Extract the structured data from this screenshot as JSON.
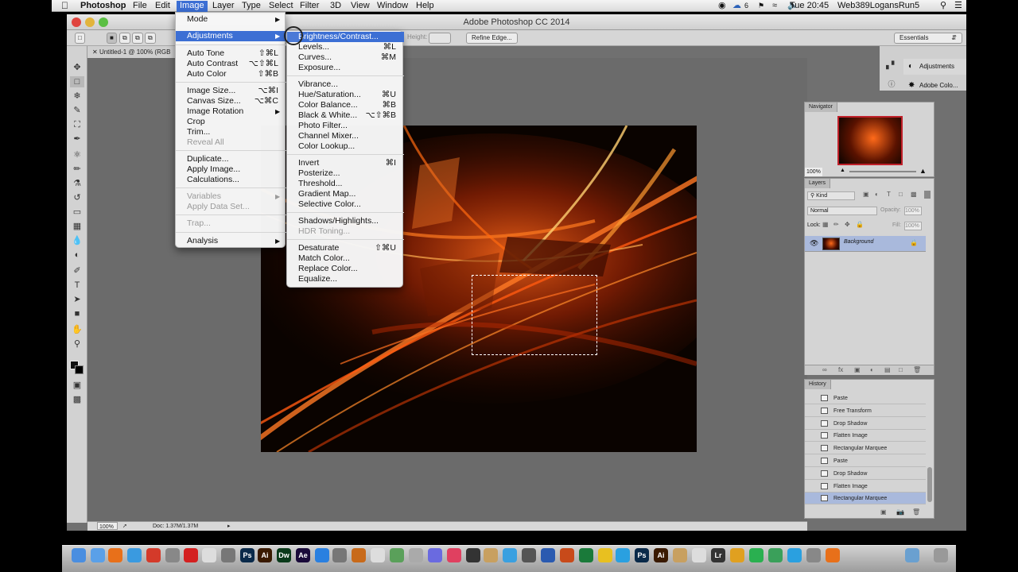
{
  "menubar": {
    "app_name": "Photoshop",
    "menus": [
      "File",
      "Edit",
      "Image",
      "Layer",
      "Type",
      "Select",
      "Filter",
      "3D",
      "View",
      "Window",
      "Help"
    ],
    "active_menu": "Image",
    "wifi_badge": "6",
    "clock": "Tue 20:45",
    "user": "Web389LogansRun5"
  },
  "window": {
    "title": "Adobe Photoshop CC 2014",
    "document_tab": "Untitled-1 @ 100% (RGB",
    "zoom": "100%",
    "doc_size": "Doc: 1.37M/1.37M",
    "options": {
      "height_label": "Height:",
      "refine_edge": "Refine Edge...",
      "workspace": "Essentials"
    }
  },
  "image_menu": {
    "items": [
      {
        "label": "Mode",
        "shortcut": "",
        "submenu": true,
        "disabled": false,
        "highlighted": false
      },
      {
        "label": "Adjustments",
        "shortcut": "",
        "submenu": true,
        "disabled": false,
        "highlighted": true
      },
      {
        "label": "Auto Tone",
        "shortcut": "⇧⌘L",
        "submenu": false,
        "disabled": false,
        "highlighted": false
      },
      {
        "label": "Auto Contrast",
        "shortcut": "⌥⇧⌘L",
        "submenu": false,
        "disabled": false,
        "highlighted": false
      },
      {
        "label": "Auto Color",
        "shortcut": "⇧⌘B",
        "submenu": false,
        "disabled": false,
        "highlighted": false
      },
      {
        "label": "Image Size...",
        "shortcut": "⌥⌘I",
        "submenu": false,
        "disabled": false,
        "highlighted": false
      },
      {
        "label": "Canvas Size...",
        "shortcut": "⌥⌘C",
        "submenu": false,
        "disabled": false,
        "highlighted": false
      },
      {
        "label": "Image Rotation",
        "shortcut": "",
        "submenu": true,
        "disabled": false,
        "highlighted": false
      },
      {
        "label": "Crop",
        "shortcut": "",
        "submenu": false,
        "disabled": false,
        "highlighted": false
      },
      {
        "label": "Trim...",
        "shortcut": "",
        "submenu": false,
        "disabled": false,
        "highlighted": false
      },
      {
        "label": "Reveal All",
        "shortcut": "",
        "submenu": false,
        "disabled": true,
        "highlighted": false
      },
      {
        "label": "Duplicate...",
        "shortcut": "",
        "submenu": false,
        "disabled": false,
        "highlighted": false
      },
      {
        "label": "Apply Image...",
        "shortcut": "",
        "submenu": false,
        "disabled": false,
        "highlighted": false
      },
      {
        "label": "Calculations...",
        "shortcut": "",
        "submenu": false,
        "disabled": false,
        "highlighted": false
      },
      {
        "label": "Variables",
        "shortcut": "",
        "submenu": true,
        "disabled": true,
        "highlighted": false
      },
      {
        "label": "Apply Data Set...",
        "shortcut": "",
        "submenu": false,
        "disabled": true,
        "highlighted": false
      },
      {
        "label": "Trap...",
        "shortcut": "",
        "submenu": false,
        "disabled": true,
        "highlighted": false
      },
      {
        "label": "Analysis",
        "shortcut": "",
        "submenu": true,
        "disabled": false,
        "highlighted": false
      }
    ]
  },
  "adjustments_menu": {
    "items": [
      {
        "label": "Brightness/Contrast...",
        "shortcut": "",
        "disabled": false,
        "highlighted": true
      },
      {
        "label": "Levels...",
        "shortcut": "⌘L",
        "disabled": false,
        "highlighted": false
      },
      {
        "label": "Curves...",
        "shortcut": "⌘M",
        "disabled": false,
        "highlighted": false
      },
      {
        "label": "Exposure...",
        "shortcut": "",
        "disabled": false,
        "highlighted": false
      },
      {
        "label": "Vibrance...",
        "shortcut": "",
        "disabled": false,
        "highlighted": false
      },
      {
        "label": "Hue/Saturation...",
        "shortcut": "⌘U",
        "disabled": false,
        "highlighted": false
      },
      {
        "label": "Color Balance...",
        "shortcut": "⌘B",
        "disabled": false,
        "highlighted": false
      },
      {
        "label": "Black & White...",
        "shortcut": "⌥⇧⌘B",
        "disabled": false,
        "highlighted": false
      },
      {
        "label": "Photo Filter...",
        "shortcut": "",
        "disabled": false,
        "highlighted": false
      },
      {
        "label": "Channel Mixer...",
        "shortcut": "",
        "disabled": false,
        "highlighted": false
      },
      {
        "label": "Color Lookup...",
        "shortcut": "",
        "disabled": false,
        "highlighted": false
      },
      {
        "label": "Invert",
        "shortcut": "⌘I",
        "disabled": false,
        "highlighted": false
      },
      {
        "label": "Posterize...",
        "shortcut": "",
        "disabled": false,
        "highlighted": false
      },
      {
        "label": "Threshold...",
        "shortcut": "",
        "disabled": false,
        "highlighted": false
      },
      {
        "label": "Gradient Map...",
        "shortcut": "",
        "disabled": false,
        "highlighted": false
      },
      {
        "label": "Selective Color...",
        "shortcut": "",
        "disabled": false,
        "highlighted": false
      },
      {
        "label": "Shadows/Highlights...",
        "shortcut": "",
        "disabled": false,
        "highlighted": false
      },
      {
        "label": "HDR Toning...",
        "shortcut": "",
        "disabled": true,
        "highlighted": false
      },
      {
        "label": "Desaturate",
        "shortcut": "⇧⌘U",
        "disabled": false,
        "highlighted": false
      },
      {
        "label": "Match Color...",
        "shortcut": "",
        "disabled": false,
        "highlighted": false
      },
      {
        "label": "Replace Color...",
        "shortcut": "",
        "disabled": false,
        "highlighted": false
      },
      {
        "label": "Equalize...",
        "shortcut": "",
        "disabled": false,
        "highlighted": false
      }
    ]
  },
  "panels": {
    "side_buttons": [
      "Adjustments",
      "Adobe Colo..."
    ],
    "navigator": {
      "title": "Navigator",
      "zoom": "100%"
    },
    "layers": {
      "title": "Layers",
      "filter": "Kind",
      "blend_mode": "Normal",
      "opacity_label": "Opacity:",
      "opacity": "100%",
      "lock_label": "Lock:",
      "fill_label": "Fill:",
      "fill": "100%",
      "layer_name": "Background"
    },
    "history": {
      "title": "History",
      "items": [
        "Paste",
        "Free Transform",
        "Drop Shadow",
        "Flatten Image",
        "Rectangular Marquee",
        "Paste",
        "Drop Shadow",
        "Flatten Image",
        "Rectangular Marquee"
      ],
      "selected_index": 8
    }
  },
  "dock": {
    "labels": [
      "Ps",
      "Ai",
      "Dw",
      "Ae",
      "Ps",
      "Ai",
      "Lr"
    ]
  },
  "colors": {
    "highlight": "#3c6fd4",
    "layer_selected": "#a9b9dc",
    "app_background": "#6b6b6b"
  }
}
